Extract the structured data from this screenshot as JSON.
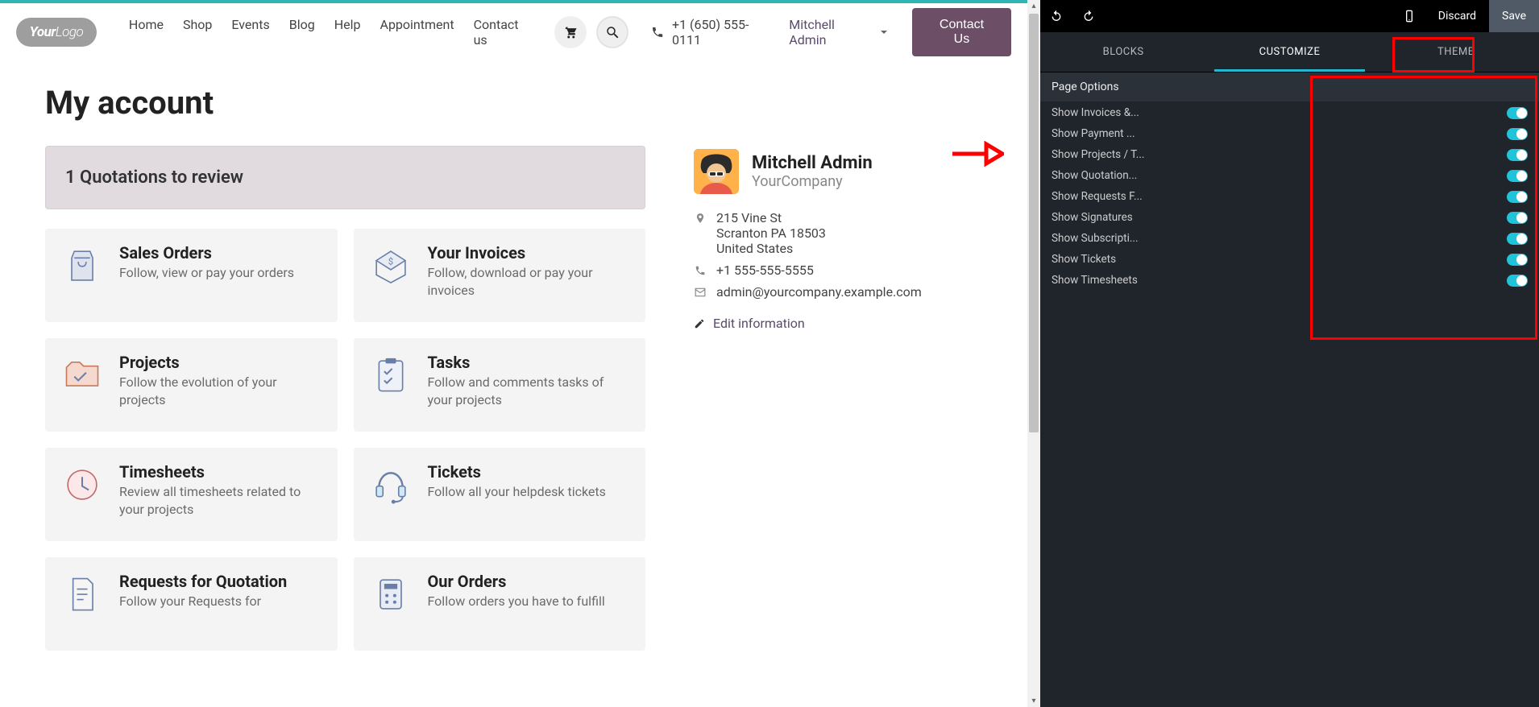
{
  "header": {
    "logo_text1": "Your",
    "logo_text2": "Logo",
    "nav": [
      "Home",
      "Shop",
      "Events",
      "Blog",
      "Help",
      "Appointment",
      "Contact us"
    ],
    "phone": "+1 (650) 555-0111",
    "user": "Mitchell Admin",
    "contact_btn": "Contact Us"
  },
  "page": {
    "title": "My account",
    "review_banner": "1 Quotations to review"
  },
  "cards": [
    {
      "title": "Sales Orders",
      "desc": "Follow, view or pay your orders"
    },
    {
      "title": "Your Invoices",
      "desc": "Follow, download or pay your invoices"
    },
    {
      "title": "Projects",
      "desc": "Follow the evolution of your projects"
    },
    {
      "title": "Tasks",
      "desc": "Follow and comments tasks of your projects"
    },
    {
      "title": "Timesheets",
      "desc": "Review all timesheets related to your projects"
    },
    {
      "title": "Tickets",
      "desc": "Follow all your helpdesk tickets"
    },
    {
      "title": "Requests for Quotation",
      "desc": "Follow your Requests for"
    },
    {
      "title": "Our Orders",
      "desc": "Follow orders you have to fulfill"
    }
  ],
  "profile": {
    "name": "Mitchell Admin",
    "company": "YourCompany",
    "addr1": "215 Vine St",
    "addr2": "Scranton PA 18503",
    "addr3": "United States",
    "phone": "+1 555-555-5555",
    "email": "admin@yourcompany.example.com",
    "edit": "Edit information"
  },
  "editor": {
    "discard": "Discard",
    "save": "Save",
    "tabs": [
      "BLOCKS",
      "CUSTOMIZE",
      "THEME"
    ],
    "section": "Page Options",
    "options": [
      {
        "label": "Show Invoices &...",
        "on": true
      },
      {
        "label": "Show Payment ...",
        "on": true
      },
      {
        "label": "Show Projects / T...",
        "on": true
      },
      {
        "label": "Show Quotation...",
        "on": true
      },
      {
        "label": "Show Requests F...",
        "on": true
      },
      {
        "label": "Show Signatures",
        "on": true
      },
      {
        "label": "Show Subscripti...",
        "on": true
      },
      {
        "label": "Show Tickets",
        "on": true
      },
      {
        "label": "Show Timesheets",
        "on": true
      }
    ]
  }
}
